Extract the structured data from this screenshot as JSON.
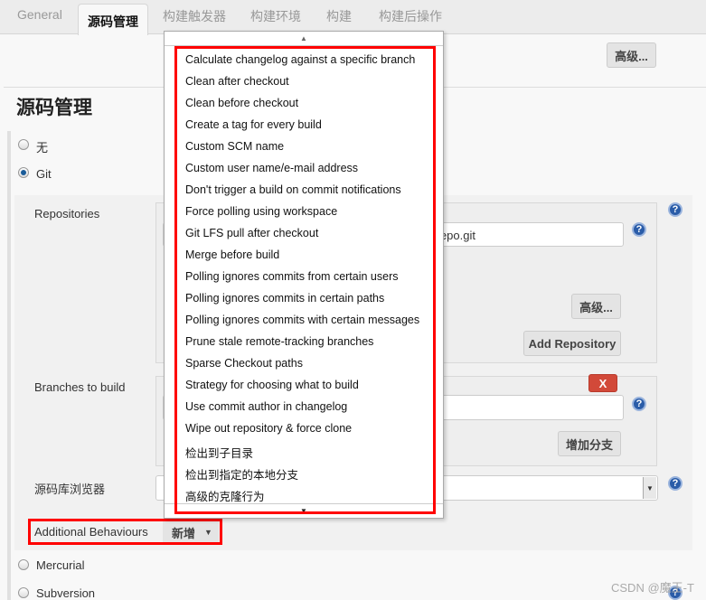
{
  "tabs": [
    "General",
    "源码管理",
    "构建触发器",
    "构建环境",
    "构建",
    "构建后操作"
  ],
  "top_advanced": "高级...",
  "section_title": "源码管理",
  "scm_options": {
    "none": "无",
    "git": "Git",
    "mercurial": "Mercurial",
    "subversion": "Subversion"
  },
  "selected_scm": "Git",
  "git": {
    "repositories_label": "Repositories",
    "repo_url_value": "epo.git",
    "advanced": "高级...",
    "add_repository": "Add Repository",
    "branches_label": "Branches to build",
    "delete_label": "X",
    "add_branch": "增加分支",
    "browser_label": "源码库浏览器",
    "additional_label": "Additional Behaviours",
    "add_button": "新增"
  },
  "menu_items": [
    "Calculate changelog against a specific branch",
    "Clean after checkout",
    "Clean before checkout",
    "Create a tag for every build",
    "Custom SCM name",
    "Custom user name/e-mail address",
    "Don't trigger a build on commit notifications",
    "Force polling using workspace",
    "Git LFS pull after checkout",
    "Merge before build",
    "Polling ignores commits from certain users",
    "Polling ignores commits in certain paths",
    "Polling ignores commits with certain messages",
    "Prune stale remote-tracking branches",
    "Sparse Checkout paths",
    "Strategy for choosing what to build",
    "Use commit author in changelog",
    "Wipe out repository & force clone",
    "检出到子目录",
    "检出到指定的本地分支",
    "高级的克隆行为"
  ],
  "watermark": "CSDN @魔王-T",
  "colors": {
    "highlight": "#ff0000",
    "delete": "#d24939",
    "help": "#2a5ca8"
  }
}
